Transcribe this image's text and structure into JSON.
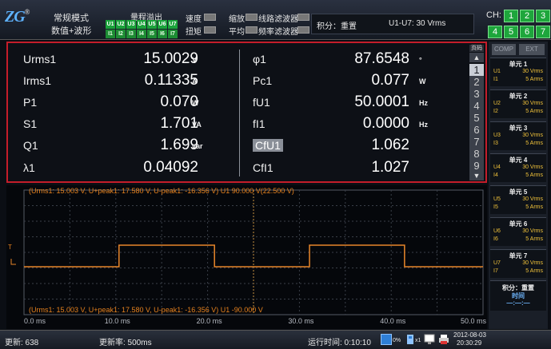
{
  "header": {
    "mode_line1": "常规模式",
    "mode_line2": "数值+波形",
    "range_overflow_title": "量程溢出",
    "u_channels": [
      "U1",
      "U2",
      "U3",
      "U4",
      "U5",
      "U6",
      "U7"
    ],
    "i_channels": [
      "I1",
      "I2",
      "I3",
      "I4",
      "I5",
      "I6",
      "I7"
    ],
    "speed_label": "速度",
    "torque_label": "扭矩",
    "zoom_label": "缩放",
    "average_label": "平均",
    "line_filter_label": "线路滤波器",
    "freq_filter_label": "频率滤波器",
    "integration_label": "积分：重置",
    "voltage_range": "U1-U7: 30 Vrms",
    "ch_label": "CH:",
    "ch_buttons": [
      "1",
      "2",
      "3",
      "4",
      "5",
      "6",
      "7"
    ]
  },
  "measurements": {
    "left": [
      {
        "label": "Urms1",
        "value": "15.0029",
        "unit": "V"
      },
      {
        "label": "Irms1",
        "value": "0.11335",
        "unit": "A"
      },
      {
        "label": "P1",
        "value": "0.070",
        "unit": "W"
      },
      {
        "label": "S1",
        "value": "1.701",
        "unit": "VA"
      },
      {
        "label": "Q1",
        "value": "1.699",
        "unit": "var"
      },
      {
        "label": "λ1",
        "value": "0.04092",
        "unit": ""
      }
    ],
    "right": [
      {
        "label": "φ1",
        "value": "87.6548",
        "unit": "°"
      },
      {
        "label": "Pc1",
        "value": "0.077",
        "unit": "W"
      },
      {
        "label": "fU1",
        "value": "50.0001",
        "unit": "Hz"
      },
      {
        "label": "fI1",
        "value": "0.0000",
        "unit": "Hz"
      },
      {
        "label": "CfU1",
        "value": "1.062",
        "unit": ""
      },
      {
        "label": "CfI1",
        "value": "1.027",
        "unit": ""
      }
    ],
    "pager_label": "页码",
    "pages": [
      "1",
      "2",
      "3",
      "4",
      "5",
      "6",
      "7",
      "8",
      "9"
    ],
    "active_page": "1"
  },
  "waveform": {
    "info_top": "(Urms1: 15.003 V, U+peak1: 17.580 V, U-peak1: -16.356 V) U1   90.000 V(22.500 V)",
    "info_bottom": "(Urms1: 15.003 V, U+peak1: 17.580 V, U-peak1: -16.356 V) U1   -90.000 V",
    "trigger_marker": "T",
    "time_ticks": [
      "0.0 ms",
      "10.0 ms",
      "20.0 ms",
      "30.0 ms",
      "40.0 ms",
      "50.0 ms"
    ],
    "trace_color": "#e8862a",
    "grid_color": "#3a3f48"
  },
  "sidebar": {
    "comp_label": "COMP",
    "ext_label": "EXT",
    "units": [
      {
        "title": "单元 1",
        "u": "U1",
        "u_range": "30 Vrms",
        "i": "I1",
        "i_range": "5 Arms"
      },
      {
        "title": "单元 2",
        "u": "U2",
        "u_range": "30 Vrms",
        "i": "I2",
        "i_range": "5 Arms"
      },
      {
        "title": "单元 3",
        "u": "U3",
        "u_range": "30 Vrms",
        "i": "I3",
        "i_range": "5 Arms"
      },
      {
        "title": "单元 4",
        "u": "U4",
        "u_range": "30 Vrms",
        "i": "I4",
        "i_range": "5 Arms"
      },
      {
        "title": "单元 5",
        "u": "U5",
        "u_range": "30 Vrms",
        "i": "I5",
        "i_range": "5 Arms"
      },
      {
        "title": "单元 6",
        "u": "U6",
        "u_range": "30 Vrms",
        "i": "I6",
        "i_range": "5 Arms"
      },
      {
        "title": "单元 7",
        "u": "U7",
        "u_range": "30 Vrms",
        "i": "I7",
        "i_range": "5 Arms"
      }
    ],
    "integration_title": "积分：重置",
    "integration_time_label": "时间",
    "integration_time_value": "—:—:—"
  },
  "status": {
    "update_label": "更新: 638",
    "update_rate": "更新率: 500ms",
    "run_time": "运行时间: 0:10:10",
    "percent": "0%",
    "x1": "x1",
    "date": "2012-08-03",
    "time": "20:30:29"
  }
}
